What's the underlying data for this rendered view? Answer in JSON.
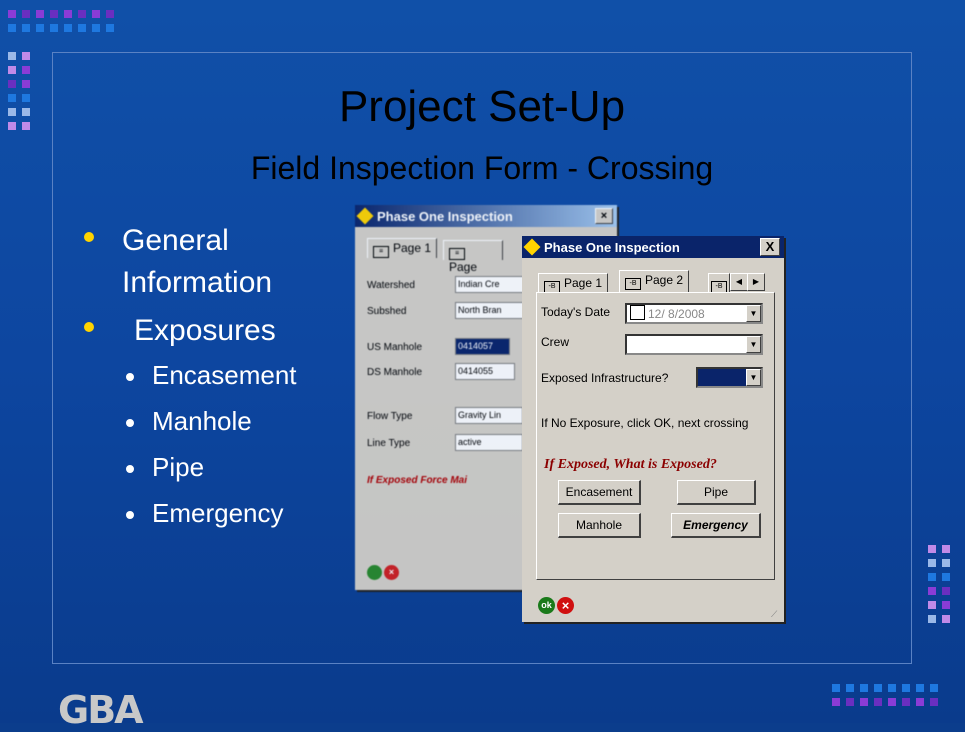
{
  "slide": {
    "title": "Project Set-Up",
    "subtitle": "Field Inspection Form - Crossing",
    "bullets": [
      {
        "label": "General Information",
        "line1": "General",
        "line2": "Information"
      },
      {
        "label": "Exposures"
      }
    ],
    "sub_bullets": [
      "Encasement",
      "Manhole",
      "Pipe",
      "Emergency"
    ],
    "logo": "GBA"
  },
  "back_window": {
    "title": "Phase One Inspection",
    "tabs": [
      "Page 1",
      "Page"
    ],
    "fields": [
      {
        "label": "Watershed",
        "value": "Indian Cre"
      },
      {
        "label": "Subshed",
        "value": "North Bran"
      },
      {
        "label": "US Manhole",
        "value": "0414057"
      },
      {
        "label": "DS Manhole",
        "value": "0414055"
      },
      {
        "label": "Flow Type",
        "value": "Gravity Lin"
      },
      {
        "label": "Line Type",
        "value": "active"
      }
    ],
    "warning": "If Exposed Force Mai"
  },
  "front_window": {
    "title": "Phase One Inspection",
    "close": "X",
    "tabs": [
      "Page 1",
      "Page 2"
    ],
    "todays_date_label": "Today's Date",
    "todays_date_value": "12/ 8/2008",
    "crew_label": "Crew",
    "crew_value": "",
    "exposed_label": "Exposed Infrastructure?",
    "hint": "If No Exposure, click OK, next crossing",
    "question": "If Exposed, What is Exposed?",
    "buttons": {
      "encasement": "Encasement",
      "pipe": "Pipe",
      "manhole": "Manhole",
      "emergency": "Emergency"
    },
    "ok": "ok",
    "cancel": "×"
  },
  "colors": {
    "background": "#0d46a0",
    "bullet": "#ffd400",
    "question": "#8b0000",
    "exposed_fill": "#0a246a"
  }
}
